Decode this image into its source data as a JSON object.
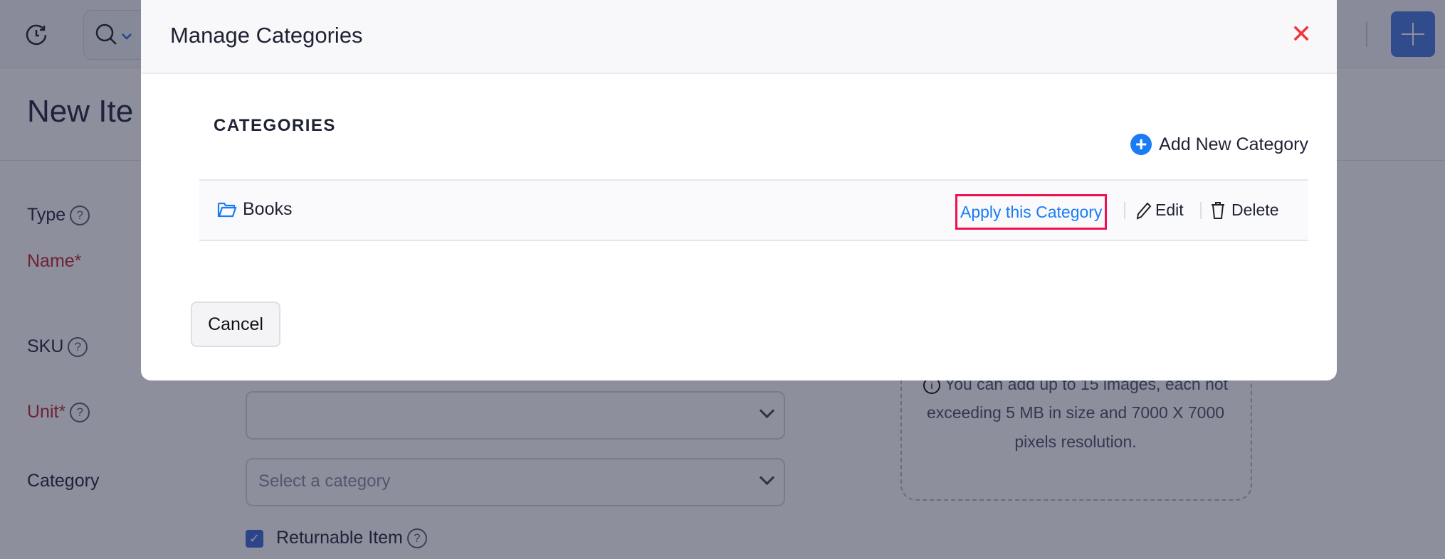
{
  "topbar": {
    "recent_icon": "history-clock-icon",
    "search_icon": "search-icon",
    "add_icon": "plus-icon",
    "accent": "#4478e0"
  },
  "page": {
    "title": "New Ite",
    "fields": {
      "type": "Type",
      "name": "Name*",
      "sku": "SKU",
      "unit": "Unit*",
      "category": "Category",
      "category_placeholder": "Select a category",
      "returnable": "Returnable Item"
    },
    "help_glyph": "?",
    "dropzone": {
      "line1": "You can add up to 15 images, each not",
      "line2": "exceeding 5 MB in size and 7000 X 7000",
      "line3": "pixels resolution."
    }
  },
  "modal": {
    "title": "Manage Categories",
    "close_glyph": "✕",
    "section_heading": "CATEGORIES",
    "add_new": "Add New Category",
    "categories": [
      {
        "name": "Books",
        "apply": "Apply this Category",
        "edit": "Edit",
        "delete": "Delete"
      }
    ],
    "cancel": "Cancel",
    "colors": {
      "link": "#1a7cf5",
      "highlight": "#f0104e",
      "close": "#f0363d"
    }
  }
}
